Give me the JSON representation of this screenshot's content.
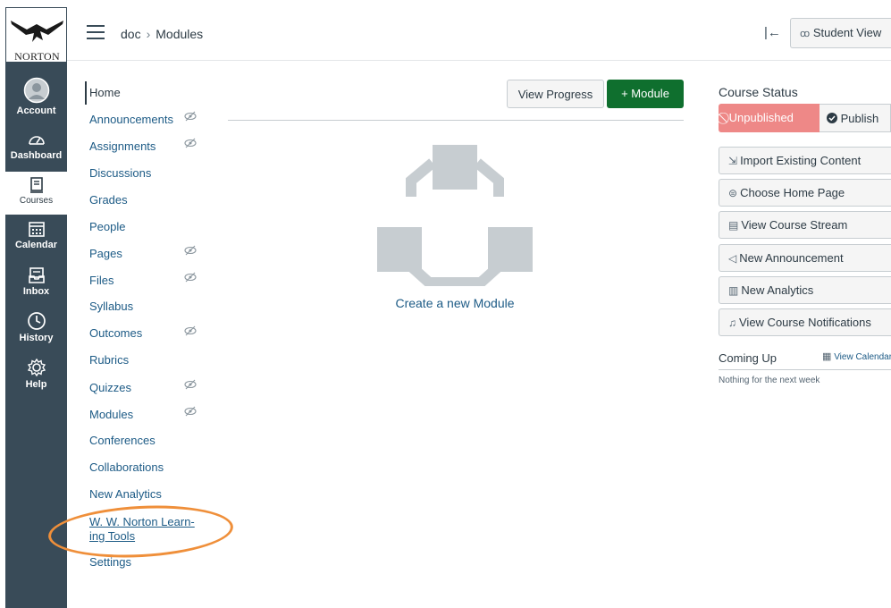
{
  "global_nav": {
    "logo_text": "NORTON",
    "items": [
      {
        "label": "Account",
        "icon": "account-icon"
      },
      {
        "label": "Dashboard",
        "icon": "dashboard-icon"
      },
      {
        "label": "Courses",
        "icon": "courses-icon"
      },
      {
        "label": "Calendar",
        "icon": "calendar-icon"
      },
      {
        "label": "Inbox",
        "icon": "inbox-icon"
      },
      {
        "label": "History",
        "icon": "history-icon"
      },
      {
        "label": "Help",
        "icon": "help-icon"
      }
    ],
    "active": "Courses"
  },
  "header": {
    "breadcrumb": [
      "doc",
      "Modules"
    ],
    "collapse_glyph": "|←",
    "student_view_label": "Student View"
  },
  "course_nav": {
    "items": [
      {
        "label": "Home",
        "hidden": false
      },
      {
        "label": "Announcements",
        "hidden": true
      },
      {
        "label": "Assignments",
        "hidden": true
      },
      {
        "label": "Discussions",
        "hidden": false
      },
      {
        "label": "Grades",
        "hidden": false
      },
      {
        "label": "People",
        "hidden": false
      },
      {
        "label": "Pages",
        "hidden": true
      },
      {
        "label": "Files",
        "hidden": true
      },
      {
        "label": "Syllabus",
        "hidden": false
      },
      {
        "label": "Outcomes",
        "hidden": true
      },
      {
        "label": "Rubrics",
        "hidden": false
      },
      {
        "label": "Quizzes",
        "hidden": true
      },
      {
        "label": "Modules",
        "hidden": true
      },
      {
        "label": "Conferences",
        "hidden": false
      },
      {
        "label": "Collaborations",
        "hidden": false
      },
      {
        "label": "New Analytics",
        "hidden": false
      }
    ],
    "norton_tools_line1": "W. W. Norton Learn-",
    "norton_tools_line2": "ing Tools",
    "settings_label": "Settings"
  },
  "main": {
    "view_progress_label": "View Progress",
    "add_module_label": "+ Module",
    "create_module_label": "Create a new Module"
  },
  "sidebar": {
    "course_status_title": "Course Status",
    "unpublished_label": "Unpublished",
    "publish_label": "Publish",
    "buttons": [
      {
        "label": "Import Existing Content",
        "icon": "import-icon"
      },
      {
        "label": "Choose Home Page",
        "icon": "home-page-icon"
      },
      {
        "label": "View Course Stream",
        "icon": "stream-icon"
      },
      {
        "label": "New Announcement",
        "icon": "announcement-icon"
      },
      {
        "label": "New Analytics",
        "icon": "analytics-icon"
      },
      {
        "label": "View Course Notifications",
        "icon": "bell-icon"
      }
    ],
    "coming_up_title": "Coming Up",
    "view_calendar_label": "View Calendar",
    "nothing_text": "Nothing for the next week"
  },
  "colors": {
    "nav_bg": "#394b58",
    "link": "#1d5b86",
    "module_green": "#0f6f2e",
    "unpublished_red": "#ee8887",
    "annotation_orange": "#ef8f3a"
  }
}
